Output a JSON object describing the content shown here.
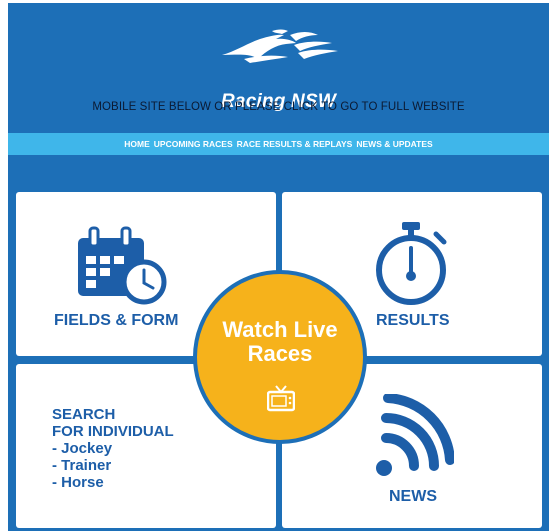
{
  "header": {
    "brand": "Racing NSW",
    "full_site_text": "MOBILE SITE BELOW OR PLEASE CLICK TO GO TO FULL WEBSITE"
  },
  "nav": {
    "items": [
      "HOME",
      "UPCOMING RACES",
      "RACE RESULTS & REPLAYS",
      "NEWS & UPDATES"
    ]
  },
  "tiles": {
    "fields": {
      "label": "FIELDS & FORM",
      "icon": "calendar-clock-icon"
    },
    "results": {
      "label": "RESULTS",
      "icon": "stopwatch-icon"
    },
    "search": {
      "title_line1": "SEARCH",
      "title_line2": "FOR INDIVIDUAL",
      "options": [
        "- Jockey",
        "- Trainer",
        "- Horse"
      ]
    },
    "news": {
      "label": "NEWS",
      "icon": "rss-feed-icon"
    }
  },
  "live": {
    "title_line1": "Watch Live",
    "title_line2": "Races",
    "icon": "tv-icon"
  },
  "colors": {
    "background_blue": "#1d6fb7",
    "nav_cyan": "#3fb6ea",
    "tile_text_blue": "#1d5ea8",
    "live_yellow": "#f6b21b"
  }
}
